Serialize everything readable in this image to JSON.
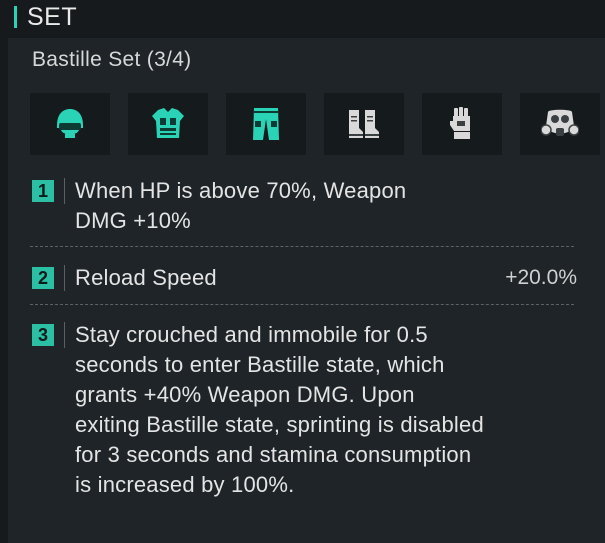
{
  "section": {
    "title": "SET"
  },
  "set": {
    "name": "Bastille Set (3/4)"
  },
  "slots": [
    {
      "icon": "helmet-icon",
      "equipped": true
    },
    {
      "icon": "armor-vest-icon",
      "equipped": true
    },
    {
      "icon": "pants-icon",
      "equipped": true
    },
    {
      "icon": "boots-icon",
      "equipped": false
    },
    {
      "icon": "gloves-icon",
      "equipped": false
    },
    {
      "icon": "gas-mask-icon",
      "equipped": false
    }
  ],
  "bonuses": [
    {
      "number": "1",
      "text": "When HP is above 70%, Weapon DMG +10%",
      "value": ""
    },
    {
      "number": "2",
      "text": "Reload Speed",
      "value": "+20.0%"
    },
    {
      "number": "3",
      "text": "Stay crouched and immobile for 0.5 seconds to enter Bastille state, which grants +40% Weapon DMG. Upon exiting Bastille state, sprinting is disabled for 3 seconds and stamina consumption is increased by 100%.",
      "value": ""
    }
  ],
  "colors": {
    "accent": "#2bd3b6",
    "inactive": "#d9d9d9",
    "panel": "#1e2427",
    "background": "#161a1c"
  }
}
